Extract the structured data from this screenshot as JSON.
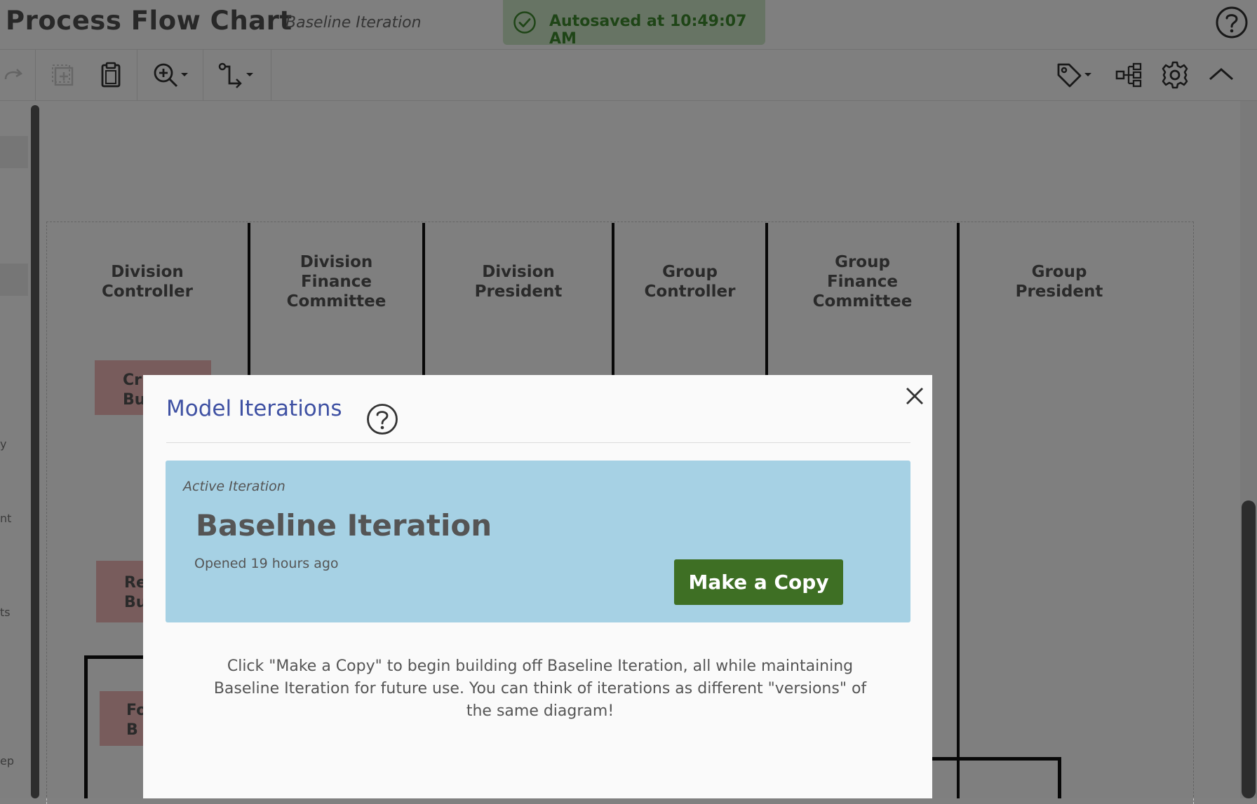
{
  "header": {
    "title": "Process Flow Chart",
    "subtitle": "Baseline Iteration",
    "autosave": "Autosaved at 10:49:07 AM"
  },
  "toolbar": {
    "left_icons": [
      "redo-icon",
      "duplicate-icon",
      "paste-icon",
      "zoom-icon",
      "connector-icon"
    ],
    "right_icons": [
      "tag-icon",
      "hierarchy-icon",
      "settings-icon",
      "collapse-icon"
    ]
  },
  "lanes": [
    {
      "title": "Division\nController"
    },
    {
      "title": "Division\nFinance\nCommittee"
    },
    {
      "title": "Division\nPresident"
    },
    {
      "title": "Group\nController"
    },
    {
      "title": "Group\nFinance\nCommittee"
    },
    {
      "title": "Group\nPresident"
    }
  ],
  "tasks": [
    "Cr\nBu",
    "Re\nBu",
    "Fo\nB"
  ],
  "side_labels": [
    "y",
    "nt",
    "ts",
    "ep"
  ],
  "modal": {
    "title": "Model Iterations",
    "card": {
      "label": "Active Iteration",
      "name": "Baseline Iteration",
      "opened": "Opened 19 hours ago",
      "button": "Make a Copy"
    },
    "description": "Click \"Make a Copy\" to begin building off Baseline Iteration, all while maintaining Baseline Iteration for future use. You can think of iterations as different \"versions\" of the same diagram!"
  },
  "colors": {
    "accent_blue": "#3f51a3",
    "card_bg": "#a6d1e4",
    "button_green": "#3e6f24",
    "autosave_green": "#3f8a2f",
    "task_pink": "#f1b8b8"
  }
}
